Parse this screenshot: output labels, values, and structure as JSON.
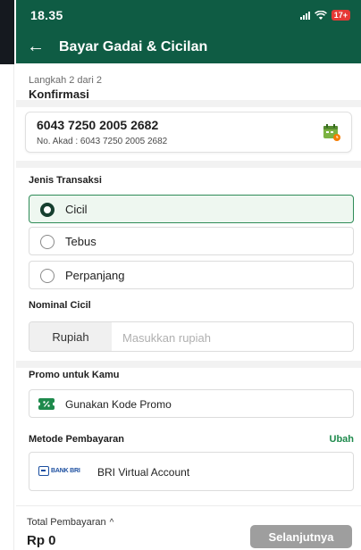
{
  "status_bar": {
    "time": "18.35",
    "battery": "17+"
  },
  "header": {
    "title": "Bayar Gadai & Cicilan"
  },
  "step": {
    "label": "Langkah 2 dari 2",
    "title": "Konfirmasi"
  },
  "contract": {
    "number": "6043 7250 2005 2682",
    "akad": "No. Akad : 6043 7250 2005 2682"
  },
  "transaction": {
    "label": "Jenis Transaksi",
    "options": [
      {
        "label": "Cicil",
        "selected": true
      },
      {
        "label": "Tebus",
        "selected": false
      },
      {
        "label": "Perpanjang",
        "selected": false
      }
    ]
  },
  "amount": {
    "label": "Nominal Cicil",
    "prefix": "Rupiah",
    "placeholder": "Masukkan rupiah",
    "value": ""
  },
  "promo": {
    "label": "Promo untuk Kamu",
    "button": "Gunakan Kode Promo"
  },
  "payment": {
    "label": "Metode Pembayaran",
    "change": "Ubah",
    "bank_logo_text": "BANK BRI",
    "method": "BRI Virtual Account"
  },
  "footer": {
    "total_label": "Total Pembayaran",
    "total_value": "Rp 0",
    "next": "Selanjutnya"
  },
  "colors": {
    "primary": "#0f5c44",
    "accent": "#1e8a4c",
    "selected_bg": "#eef7f0",
    "disabled": "#9e9e9e"
  }
}
